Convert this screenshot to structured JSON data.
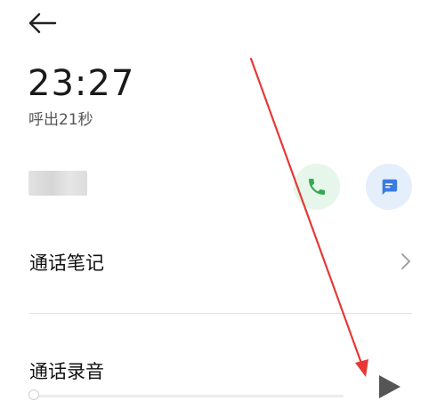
{
  "header": {
    "back_icon": "arrow-left-icon"
  },
  "call": {
    "time": "23:27",
    "detail": "呼出21秒",
    "contact_name": "██"
  },
  "actions": {
    "call_icon": "phone-icon",
    "call_color": "#34a853",
    "call_bg": "#e7f6ea",
    "message_icon": "message-icon",
    "message_color": "#3b7be0",
    "message_bg": "#e5eefb"
  },
  "notes": {
    "label": "通话笔记",
    "chevron_icon": "chevron-right-icon"
  },
  "recording": {
    "label": "通话录音",
    "progress": 0,
    "play_icon": "play-icon",
    "play_color": "#555555"
  },
  "annotation": {
    "arrow_color": "#e53935",
    "arrow_icon": "red-arrow-annotation"
  }
}
